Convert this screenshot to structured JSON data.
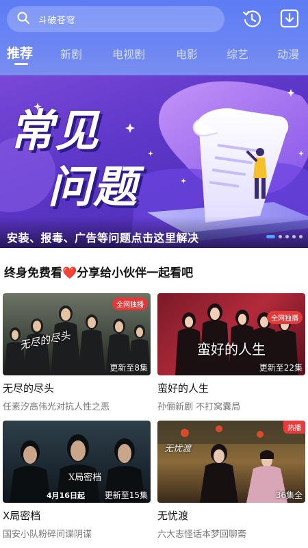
{
  "search": {
    "placeholder": "斗破苍穹"
  },
  "icons": {
    "history": "history-icon",
    "download": "download-icon",
    "search": "search-icon"
  },
  "tabs": [
    {
      "label": "推荐",
      "active": true
    },
    {
      "label": "新剧",
      "active": false
    },
    {
      "label": "电视剧",
      "active": false
    },
    {
      "label": "电影",
      "active": false
    },
    {
      "label": "综艺",
      "active": false
    },
    {
      "label": "动漫",
      "active": false
    }
  ],
  "banner": {
    "title_line1": "常见",
    "title_line2": "问题",
    "caption": "安装、报毒、广告等问题点击这里解决",
    "slide_count": 5,
    "active_slide": 0
  },
  "section": {
    "title_part1": "终身免费看",
    "title_heart": "❤️",
    "title_part2": "分享给小伙伴一起看吧"
  },
  "cards": [
    {
      "title": "无尽的尽头",
      "subtitle": "任素汐高伟光对抗人性之恶",
      "episode_tag": "更新至8集",
      "badge": "全网独播",
      "poster_text": "无尽的尽头"
    },
    {
      "title": "蛮好的人生",
      "subtitle": "孙俪新剧 不打窝囊局",
      "episode_tag": "更新至22集",
      "badge": "全网独播",
      "poster_text": "蛮好的人生"
    },
    {
      "title": "X局密档",
      "subtitle": "国安小队粉碎间谍阴谋",
      "episode_tag": "更新至15集",
      "badge": "",
      "poster_text": "X局密档",
      "poster_date": "4月16日起"
    },
    {
      "title": "无忧渡",
      "subtitle": "六大志怪话本梦回聊斋",
      "episode_tag": "36集全",
      "badge": "热播",
      "poster_text": "无忧渡"
    }
  ],
  "colors": {
    "header": "#6b86f3",
    "banner": "#5d37c9",
    "accent": "#4ea2ff",
    "badge": "#e83b3b"
  }
}
